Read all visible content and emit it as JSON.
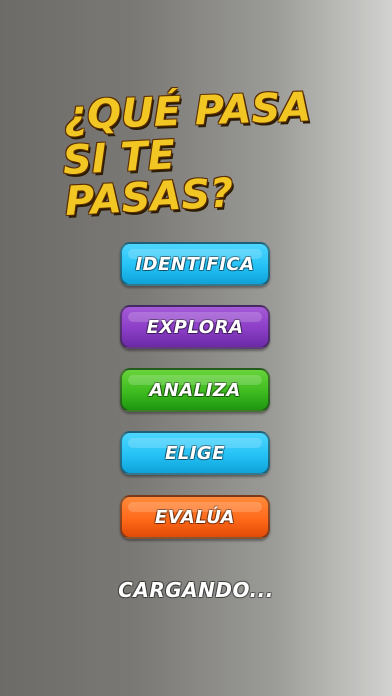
{
  "header": {
    "title_line_1": "¿QUÉ PASA",
    "title_line_2": "SI TE PASAS?"
  },
  "menu": {
    "buttons": [
      {
        "label": "IDENTIFICA",
        "color": "#25c2f6"
      },
      {
        "label": "EXPLORA",
        "color": "#8b3ec6"
      },
      {
        "label": "ANALIZA",
        "color": "#3dbb1f"
      },
      {
        "label": "ELIGE",
        "color": "#25c2f6"
      },
      {
        "label": "EVALÚA",
        "color": "#ff6a1a"
      }
    ]
  },
  "status": {
    "loading_text": "CARGANDO..."
  }
}
